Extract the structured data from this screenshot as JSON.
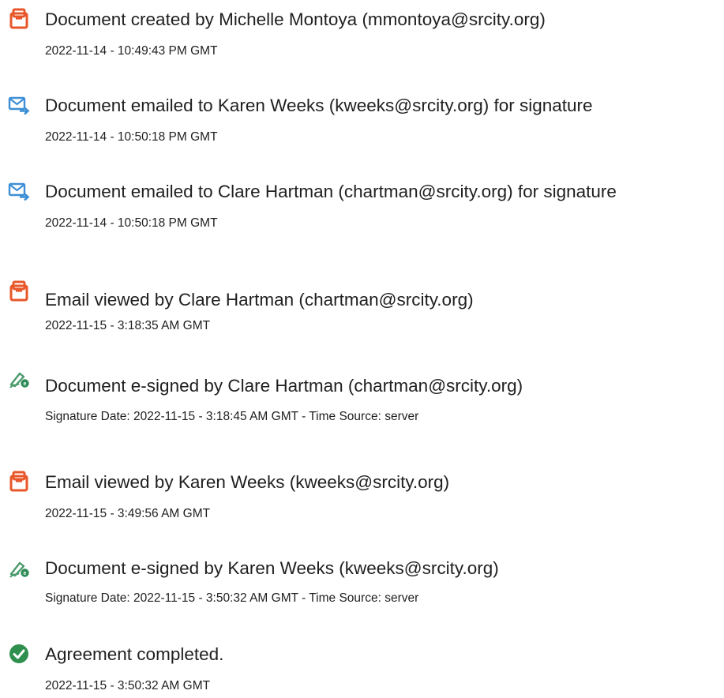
{
  "colors": {
    "document_icon": "#e8572a",
    "email_icon": "#3d8fd6",
    "signed_icon_pen": "#4b9a6c",
    "signed_icon_badge": "#2e8b57",
    "completed_icon": "#2f8f4e"
  },
  "events": [
    {
      "icon": "document-created-icon",
      "title": "Document created by Michelle Montoya (mmontoya@srcity.org)",
      "time": "2022-11-14 - 10:49:43 PM GMT"
    },
    {
      "icon": "email-sent-icon",
      "title": "Document emailed to Karen Weeks (kweeks@srcity.org) for signature",
      "time": "2022-11-14 - 10:50:18 PM GMT"
    },
    {
      "icon": "email-sent-icon",
      "title": "Document emailed to Clare Hartman (chartman@srcity.org) for signature",
      "time": "2022-11-14 - 10:50:18 PM GMT"
    },
    {
      "icon": "email-viewed-icon",
      "title": "Email viewed by Clare Hartman (chartman@srcity.org)",
      "time": "2022-11-15 - 3:18:35 AM GMT"
    },
    {
      "icon": "e-signed-icon",
      "title": "Document e-signed by Clare Hartman (chartman@srcity.org)",
      "time": "Signature Date: 2022-11-15 - 3:18:45 AM GMT - Time Source: server"
    },
    {
      "icon": "email-viewed-icon",
      "title": "Email viewed by Karen Weeks (kweeks@srcity.org)",
      "time": "2022-11-15 - 3:49:56 AM GMT"
    },
    {
      "icon": "e-signed-icon",
      "title": "Document e-signed by Karen Weeks (kweeks@srcity.org)",
      "time": "Signature Date: 2022-11-15 - 3:50:32 AM GMT - Time Source: server"
    },
    {
      "icon": "agreement-completed-icon",
      "title": "Agreement completed.",
      "time": "2022-11-15 - 3:50:32 AM GMT"
    }
  ]
}
